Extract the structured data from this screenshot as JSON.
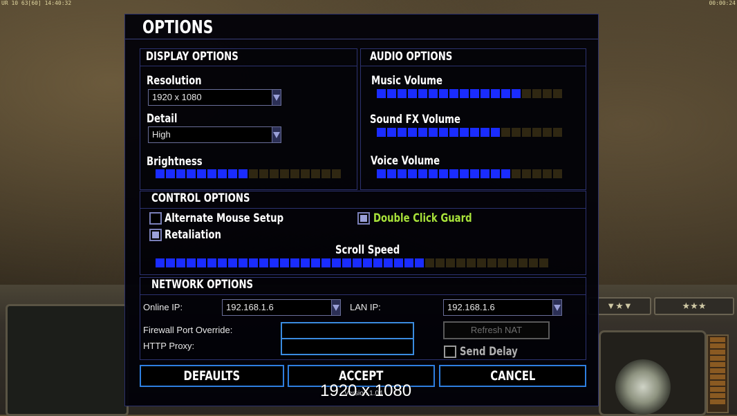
{
  "hud": {
    "top_left": "UR 10 63[60] 14:40:32",
    "top_right": "00:00:24"
  },
  "dialog": {
    "title": "OPTIONS",
    "display": {
      "heading": "DISPLAY OPTIONS",
      "resolution_label": "Resolution",
      "resolution_value": "1920 x 1080",
      "detail_label": "Detail",
      "detail_value": "High",
      "brightness_label": "Brightness",
      "brightness_level": 0.5
    },
    "audio": {
      "heading": "AUDIO OPTIONS",
      "music_label": "Music Volume",
      "music_level": 0.75,
      "sfx_label": "Sound FX Volume",
      "sfx_level": 0.65,
      "voice_label": "Voice Volume",
      "voice_level": 0.7
    },
    "control": {
      "heading": "CONTROL OPTIONS",
      "alt_mouse_label": "Alternate Mouse Setup",
      "alt_mouse_checked": false,
      "double_click_label": "Double Click Guard",
      "double_click_checked": true,
      "retaliation_label": "Retaliation",
      "retaliation_checked": true,
      "scroll_label": "Scroll Speed",
      "scroll_level": 0.68
    },
    "network": {
      "heading": "NETWORK OPTIONS",
      "online_ip_label": "Online IP:",
      "online_ip_value": "192.168.1.6",
      "lan_ip_label": "LAN IP:",
      "lan_ip_value": "192.168.1.6",
      "firewall_label": "Firewall Port Override:",
      "firewall_value": "",
      "http_proxy_label": "HTTP Proxy:",
      "http_proxy_value": "",
      "refresh_nat_label": "Refresh NAT",
      "send_delay_label": "Send Delay",
      "send_delay_checked": false
    },
    "buttons": {
      "defaults": "DEFAULTS",
      "accept": "ACCEPT",
      "cancel": "CANCEL"
    },
    "version": "Version 1.04"
  },
  "overlay_text": "1920 x 1080",
  "colors": {
    "slider_on": "#1a2cff",
    "slider_off": "#2f2712",
    "accent_border": "#2e7fe0",
    "highlight_green": "#a8e23a"
  }
}
